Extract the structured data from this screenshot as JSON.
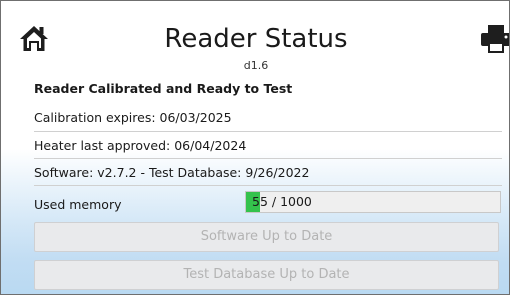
{
  "header": {
    "title": "Reader Status",
    "version": "d1.6",
    "home_icon": "home-icon",
    "print_icon": "printer-icon"
  },
  "status": {
    "headline": "Reader Calibrated and Ready to Test",
    "calibration": "Calibration expires: 06/03/2025",
    "heater": "Heater last approved: 06/04/2024",
    "software": "Software: v2.7.2 - Test Database: 9/26/2022"
  },
  "memory": {
    "label": "Used memory",
    "value_text": "55 / 1000",
    "used": 55,
    "total": 1000,
    "fill_color": "#34c24c"
  },
  "buttons": {
    "software": "Software Up to Date",
    "test_database": "Test Database Up to Date"
  },
  "colors": {
    "disabled_text": "#b3b3b3",
    "button_bg": "#e9eaec"
  }
}
